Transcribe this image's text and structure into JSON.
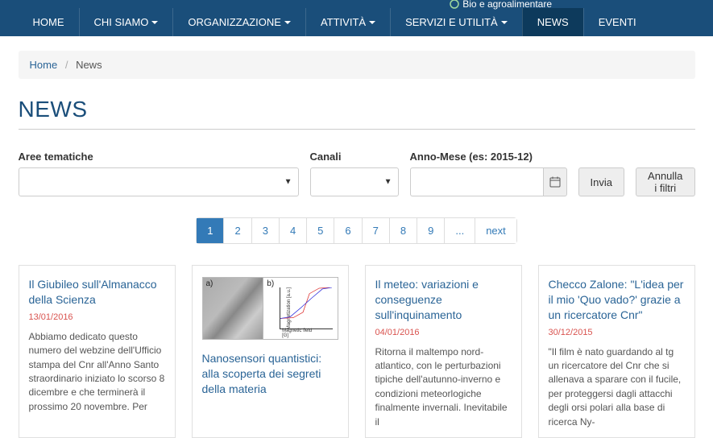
{
  "banner": {
    "tag": "Bio e agroalimentare"
  },
  "nav": {
    "items": [
      {
        "label": "HOME",
        "dropdown": false,
        "active": false
      },
      {
        "label": "CHI SIAMO",
        "dropdown": true,
        "active": false
      },
      {
        "label": "ORGANIZZAZIONE",
        "dropdown": true,
        "active": false
      },
      {
        "label": "ATTIVITÀ",
        "dropdown": true,
        "active": false
      },
      {
        "label": "SERVIZI E UTILITÀ",
        "dropdown": true,
        "active": false
      },
      {
        "label": "NEWS",
        "dropdown": false,
        "active": true
      },
      {
        "label": "EVENTI",
        "dropdown": false,
        "active": false
      }
    ]
  },
  "breadcrumb": {
    "home": "Home",
    "current": "News"
  },
  "page": {
    "title": "NEWS"
  },
  "filters": {
    "aree_label": "Aree tematiche",
    "aree_value": "",
    "canali_label": "Canali",
    "canali_value": "",
    "anno_label": "Anno-Mese (es: 2015-12)",
    "anno_value": "",
    "submit": "Invia",
    "reset": "Annulla i filtri"
  },
  "pagination": {
    "pages": [
      "1",
      "2",
      "3",
      "4",
      "5",
      "6",
      "7",
      "8",
      "9",
      "...",
      "next"
    ],
    "active_index": 0
  },
  "cards": [
    {
      "title": "Il Giubileo sull'Almanacco della Scienza",
      "date": "13/01/2016",
      "text": "Abbiamo dedicato questo numero del webzine dell'Ufficio stampa del Cnr all'Anno Santo straordinario iniziato lo scorso 8 dicembre e che terminerà il prossimo 20 novembre. Per"
    },
    {
      "title": "Nanosensori quantistici: alla scoperta dei segreti della materia",
      "date": "",
      "text": ""
    },
    {
      "title": "Il meteo: variazioni e conseguenze sull'inquinamento",
      "date": "04/01/2016",
      "text": "Ritorna il maltempo nord-atlantico, con le perturbazioni tipiche dell'autunno-inverno e condizioni meteorlogiche finalmente invernali. Inevitabile il"
    },
    {
      "title": "Checco Zalone: \"L'idea per il mio 'Quo vado?' grazie a un ricercatore Cnr\"",
      "date": "30/12/2015",
      "text": "\"Il film è nato guardando al tg un ricercatore del Cnr che si allenava a sparare con il fucile, per proteggersi dagli attacchi degli orsi polari alla base di ricerca Ny-"
    }
  ],
  "chart_data": {
    "type": "line",
    "title": "",
    "xlabel": "Magnetic field [G]",
    "ylabel": "Magnetization [a.u.]",
    "xlim": [
      -400,
      400
    ],
    "ylim": [
      -1,
      1
    ],
    "series": [
      {
        "name": "red",
        "color": "#d33",
        "x": [
          -400,
          -200,
          -50,
          0,
          50,
          200,
          400
        ],
        "y": [
          -1,
          -0.95,
          -0.6,
          0,
          0.6,
          0.95,
          1
        ]
      },
      {
        "name": "blue",
        "color": "#33d",
        "x": [
          -400,
          -250,
          -80,
          0,
          80,
          250,
          400
        ],
        "y": [
          -1,
          -0.9,
          -0.3,
          0,
          0.3,
          0.9,
          1
        ]
      }
    ]
  }
}
